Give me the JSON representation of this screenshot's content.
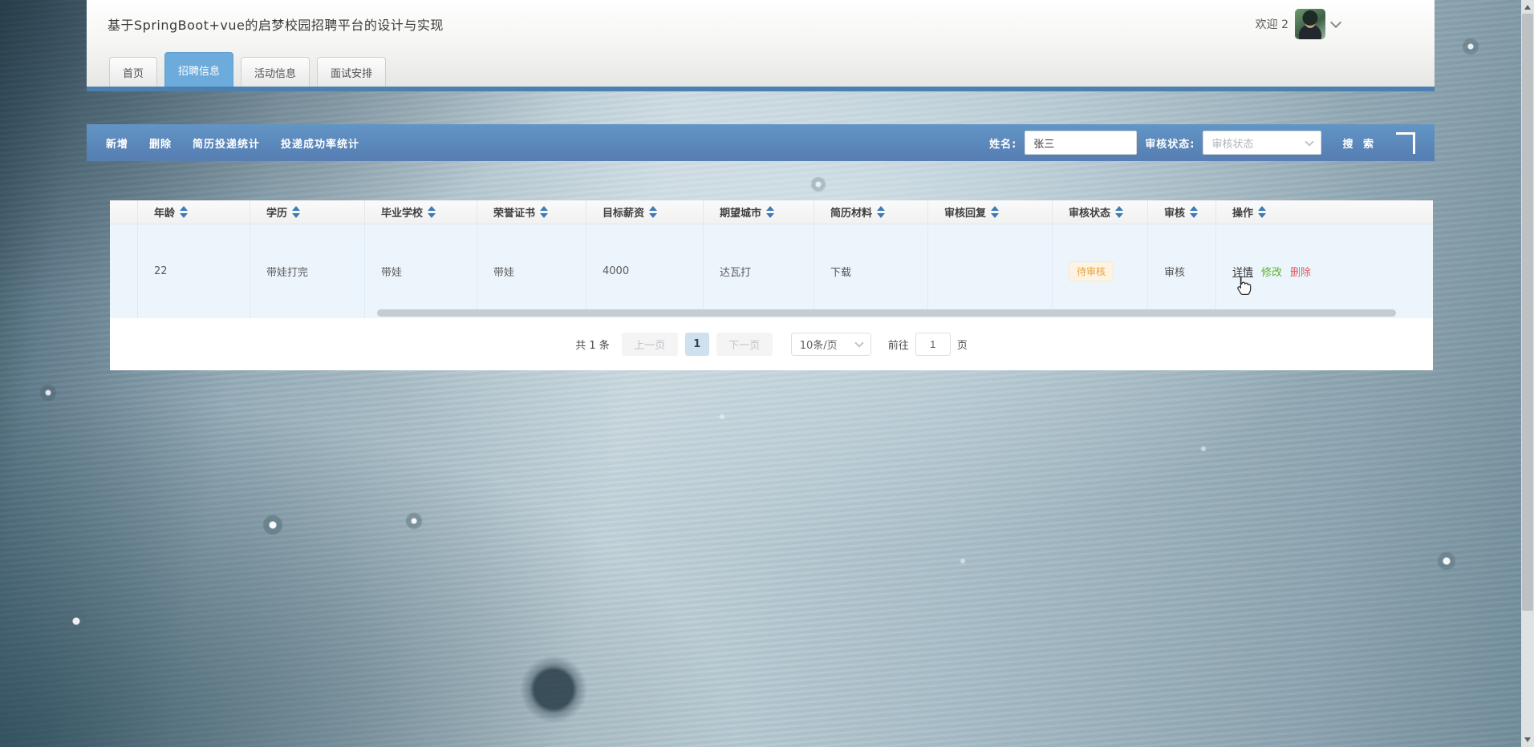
{
  "header": {
    "title": "基于SpringBoot+vue的启梦校园招聘平台的设计与实现",
    "welcome": "欢迎 2"
  },
  "tabs": [
    {
      "label": "首页",
      "active": false
    },
    {
      "label": "招聘信息",
      "active": true
    },
    {
      "label": "活动信息",
      "active": false
    },
    {
      "label": "面试安排",
      "active": false
    }
  ],
  "toolbar": {
    "add": "新增",
    "delete": "删除",
    "resume_stats": "简历投递统计",
    "success_rate_stats": "投递成功率统计",
    "name_label": "姓名:",
    "name_value": "张三",
    "status_label": "审核状态:",
    "status_placeholder": "审核状态",
    "search_label": "搜 索"
  },
  "table": {
    "columns": [
      {
        "label": ""
      },
      {
        "label": "年龄"
      },
      {
        "label": "学历"
      },
      {
        "label": "毕业学校"
      },
      {
        "label": "荣誉证书"
      },
      {
        "label": "目标薪资"
      },
      {
        "label": "期望城市"
      },
      {
        "label": "简历材料"
      },
      {
        "label": "审核回复"
      },
      {
        "label": "审核状态"
      },
      {
        "label": "审核"
      },
      {
        "label": "操作"
      }
    ],
    "row": {
      "age": "22",
      "education": "带娃打完",
      "school": "带娃",
      "certificate": "带娃",
      "salary": "4000",
      "city": "达瓦打",
      "resume_link": "下载",
      "reply": "",
      "status_badge": "待审核",
      "audit_label": "审核",
      "actions": {
        "detail": "详情",
        "edit": "修改",
        "delete": "删除"
      }
    }
  },
  "pagination": {
    "total": "共 1 条",
    "prev": "上一页",
    "current_page": "1",
    "next": "下一页",
    "page_size": "10条/页",
    "goto_label": "前往",
    "goto_value": "1",
    "goto_unit": "页"
  },
  "colors": {
    "toolbar_blue": "#5e92c3",
    "divider_blue": "#4c80b0",
    "tab_active_blue": "#6cabdc",
    "row_bg": "#edf5fc",
    "badge_bg": "#fdf3e3",
    "badge_text": "#e6a23c",
    "edit_green": "#5daf34",
    "delete_red": "#e05c5c"
  }
}
